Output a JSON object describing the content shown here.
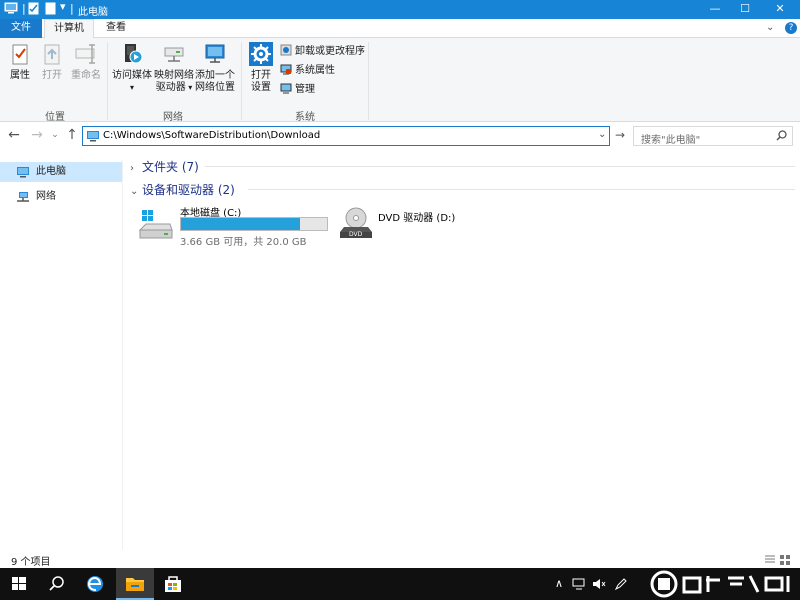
{
  "window": {
    "title": "此电脑",
    "controls": {
      "minimize": "—",
      "maximize": "☐",
      "close": "✕"
    }
  },
  "tabs": {
    "file": "文件",
    "computer": "计算机",
    "view": "查看"
  },
  "ribbon": {
    "location": {
      "label": "位置",
      "properties": "属性",
      "open": "打开",
      "rename": "重命名"
    },
    "network": {
      "label": "网络",
      "access_media": "访问媒体",
      "map_drive_1": "映射网络",
      "map_drive_2": "驱动器",
      "add_location_1": "添加一个",
      "add_location_2": "网络位置"
    },
    "system": {
      "label": "系统",
      "open_settings_1": "打开",
      "open_settings_2": "设置",
      "uninstall": "卸载或更改程序",
      "system_properties": "系统属性",
      "manage": "管理"
    }
  },
  "address": {
    "path": "C:\\Windows\\SoftwareDistribution\\Download",
    "search_placeholder": "搜索\"此电脑\""
  },
  "nav_pane": {
    "items": [
      {
        "label": "此电脑",
        "selected": true
      },
      {
        "label": "网络",
        "selected": false
      }
    ]
  },
  "content": {
    "folders_section": "文件夹 (7)",
    "devices_section": "设备和驱动器 (2)",
    "drives": [
      {
        "name": "本地磁盘 (C:)",
        "free": "3.66 GB 可用，共 20.0 GB",
        "used_fraction": 0.817
      },
      {
        "name": "DVD 驱动器 (D:)",
        "dvd_label": "DVD"
      }
    ]
  },
  "status": {
    "items_count": "9 个项目"
  },
  "colors": {
    "accent": "#1979ca",
    "titlebar": "#1784d6",
    "drive_bar": "#26a0da",
    "taskbar": "#101010"
  }
}
